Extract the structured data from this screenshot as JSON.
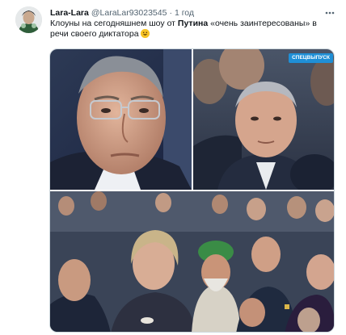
{
  "tweet": {
    "display_name": "Lara-Lara",
    "handle": "@LaraLar93023545",
    "separator": "·",
    "time": "1 год",
    "more_icon": "more-horizontal-icon",
    "text_part1": "Клоуны на сегодняшнем шоу от ",
    "text_bold": "Путина",
    "text_part2": " «очень заинтересованы» в речи своего диктатора",
    "emoji": "grinning-face-emoji"
  },
  "media": {
    "photo_count": 3,
    "channel_badge": "СПЕЦВЫПУСК"
  }
}
